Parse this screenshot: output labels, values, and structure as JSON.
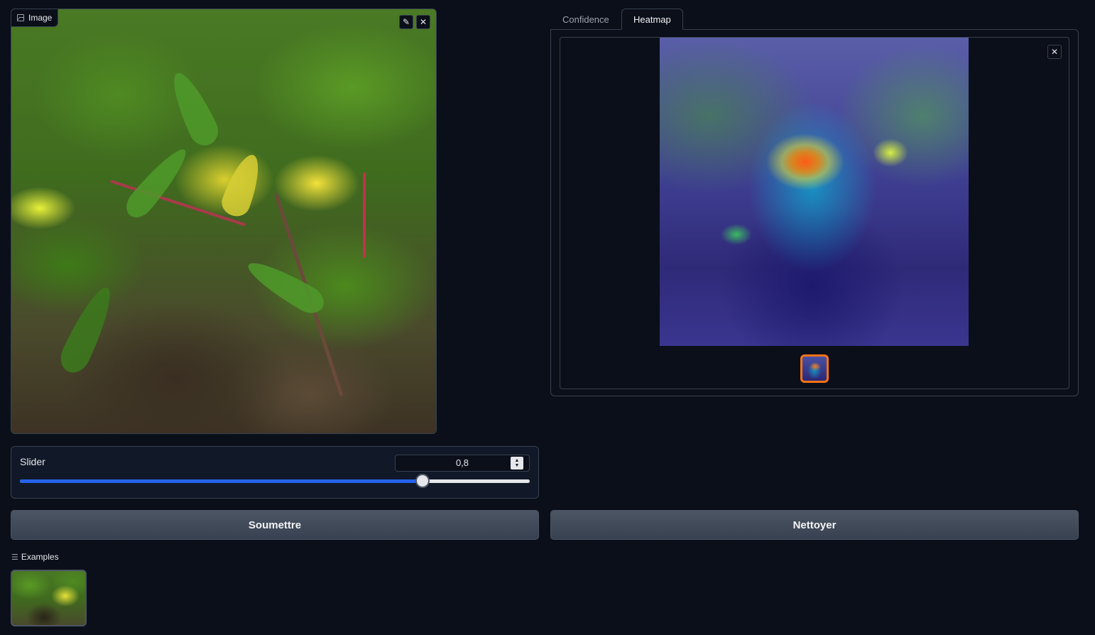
{
  "image_input": {
    "label": "Image",
    "edit_icon": "pencil-icon",
    "clear_icon": "close-icon"
  },
  "slider": {
    "label": "Slider",
    "value_text": "0,8",
    "value": 0.8,
    "fill_fraction": 0.79
  },
  "buttons": {
    "submit": "Soumettre",
    "clear": "Nettoyer"
  },
  "examples": {
    "label": "Examples"
  },
  "tabs": [
    {
      "label": "Confidence",
      "active": false
    },
    {
      "label": "Heatmap",
      "active": true
    }
  ],
  "gallery": {
    "close_icon": "close-icon",
    "selected_index": 0,
    "count": 1
  },
  "colors": {
    "background": "#0b0f19",
    "panel": "#111827",
    "border": "#374151",
    "accent_blue": "#2563eb",
    "selected_orange": "#f97316"
  }
}
